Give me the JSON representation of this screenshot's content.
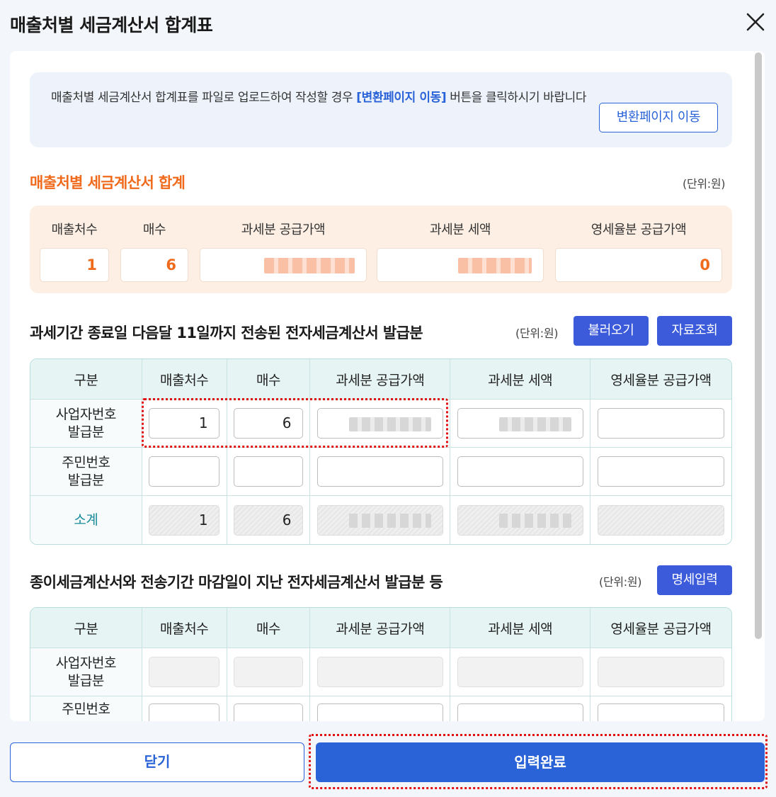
{
  "dialog": {
    "title": "매출처별 세금계산서 합계표",
    "notice": {
      "text_before": "매출처별 세금계산서 합계표를 파일로 업로드하여 작성할 경우 ",
      "highlight": "[변환페이지 이동]",
      "text_after": " 버튼을 클릭하시기 바랍니다",
      "button_label": "변환페이지 이동"
    },
    "summary": {
      "title": "매출처별 세금계산서 합계",
      "unit": "(단위:원)",
      "labels": [
        "매출처수",
        "매수",
        "과세분 공급가액",
        "과세분 세액",
        "영세율분 공급가액"
      ],
      "values": {
        "count": "1",
        "sheets": "6",
        "zero_rate": "0"
      }
    },
    "section1": {
      "title": "과세기간 종료일 다음달 11일까지 전송된 전자세금계산서 발급분",
      "unit": "(단위:원)",
      "load_button": "불러오기",
      "query_button": "자료조회",
      "headers": [
        "구분",
        "매출처수",
        "매수",
        "과세분 공급가액",
        "과세분 세액",
        "영세율분 공급가액"
      ],
      "rows": [
        {
          "label_line1": "사업자번호",
          "label_line2": "발급분",
          "count": "1",
          "sheets": "6"
        },
        {
          "label_line1": "주민번호",
          "label_line2": "발급분",
          "count": "",
          "sheets": ""
        },
        {
          "label": "소계",
          "count": "1",
          "sheets": "6"
        }
      ]
    },
    "section2": {
      "title": "종이세금계산서와 전송기간 마감일이 지난 전자세금계산서 발급분 등",
      "unit": "(단위:원)",
      "detail_button": "명세입력",
      "headers": [
        "구분",
        "매출처수",
        "매수",
        "과세분 공급가액",
        "과세분 세액",
        "영세율분 공급가액"
      ],
      "rows": [
        {
          "label_line1": "사업자번호",
          "label_line2": "발급분"
        },
        {
          "label_line1": "주민번호"
        }
      ]
    },
    "footer": {
      "close_label": "닫기",
      "submit_label": "입력완료"
    }
  }
}
